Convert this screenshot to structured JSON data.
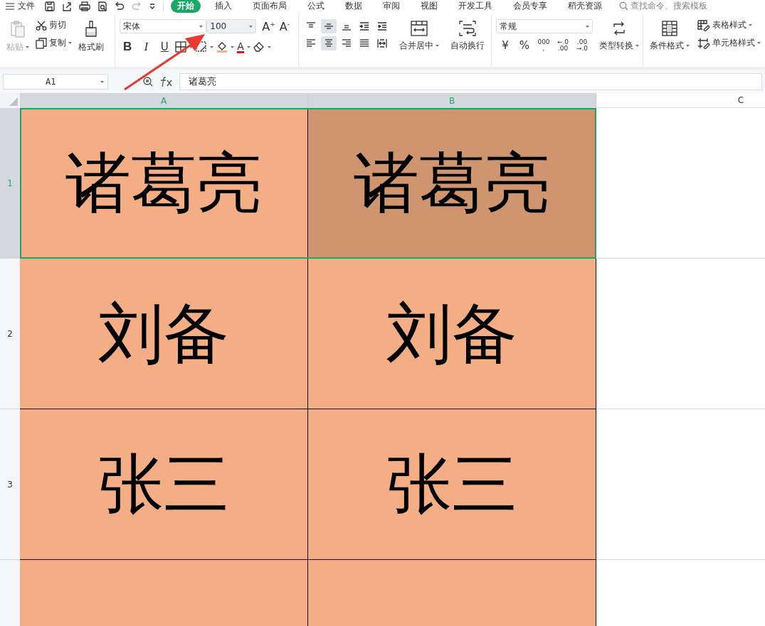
{
  "menu_bar": {
    "file_menu": "文件",
    "tabs": [
      {
        "label": "开始",
        "selected": true
      },
      {
        "label": "插入",
        "selected": false
      },
      {
        "label": "页面布局",
        "selected": false
      },
      {
        "label": "公式",
        "selected": false
      },
      {
        "label": "数据",
        "selected": false
      },
      {
        "label": "审阅",
        "selected": false
      },
      {
        "label": "视图",
        "selected": false
      },
      {
        "label": "开发工具",
        "selected": false
      },
      {
        "label": "会员专享",
        "selected": false
      },
      {
        "label": "稻壳资源",
        "selected": false
      }
    ],
    "search": {
      "placeholder": "查找命令、搜索模板"
    }
  },
  "ribbon": {
    "clipboard": {
      "paste": {
        "label": "粘贴",
        "disabled": true
      },
      "cut": "剪切",
      "copy": "复制",
      "format_painter": "格式刷"
    },
    "font": {
      "name": "宋体",
      "size": "100",
      "size_buttons": [
        "A$^{+}$",
        "A$^{-}$"
      ],
      "bold": "B",
      "italic": "I",
      "underline": "U",
      "font_color": "A"
    },
    "alignment": {
      "buttons": [
        {
          "kind": "top",
          "selected": false
        },
        {
          "kind": "middle",
          "selected": true
        },
        {
          "kind": "bottom",
          "selected": false
        },
        {
          "kind": "outdent",
          "selected": false
        },
        {
          "kind": "indent",
          "selected": false
        },
        {
          "kind": "left",
          "selected": false
        },
        {
          "kind": "center",
          "selected": true
        },
        {
          "kind": "right",
          "selected": false
        },
        {
          "kind": "justify",
          "selected": false
        },
        {
          "kind": "distribute",
          "selected": false
        }
      ],
      "merge": "合并居中",
      "wrap": "自动换行"
    },
    "number": {
      "format": "常规",
      "buttons": [
        {
          "kind": "currency",
          "lines": [
            "¥"
          ]
        },
        {
          "kind": "percent",
          "lines": [
            "%"
          ]
        },
        {
          "kind": "thousands",
          "lines": [
            "000",
            ","
          ]
        },
        {
          "kind": "decimal",
          "lines": [
            "←.0",
            ".00"
          ]
        },
        {
          "kind": "decimal",
          "lines": [
            ".00",
            "→.0"
          ]
        }
      ],
      "convert": "类型转换"
    },
    "styles": {
      "conditional": "条件格式",
      "table_style": "表格样式",
      "cell_style": "单元格样式"
    }
  },
  "formula_bar": {
    "cell_ref": "A1",
    "value": "诸葛亮"
  },
  "sheet": {
    "columns": [
      {
        "label": "A",
        "selected": true
      },
      {
        "label": "B",
        "selected": true
      },
      {
        "label": "C",
        "selected": false
      }
    ],
    "rows": [
      {
        "label": "1",
        "selected": true,
        "cells": [
          {
            "text": "诸葛亮",
            "highlighted": false
          },
          {
            "text": "诸葛亮",
            "highlighted": true
          }
        ]
      },
      {
        "label": "2",
        "selected": false,
        "cells": [
          {
            "text": "刘备",
            "highlighted": false
          },
          {
            "text": "刘备",
            "highlighted": false
          }
        ]
      },
      {
        "label": "3",
        "selected": false,
        "cells": [
          {
            "text": "张三",
            "highlighted": false
          },
          {
            "text": "张三",
            "highlighted": false
          }
        ]
      },
      {
        "selected": false,
        "cells": [
          {
            "highlighted": false
          },
          {
            "highlighted": false
          }
        ]
      }
    ]
  }
}
